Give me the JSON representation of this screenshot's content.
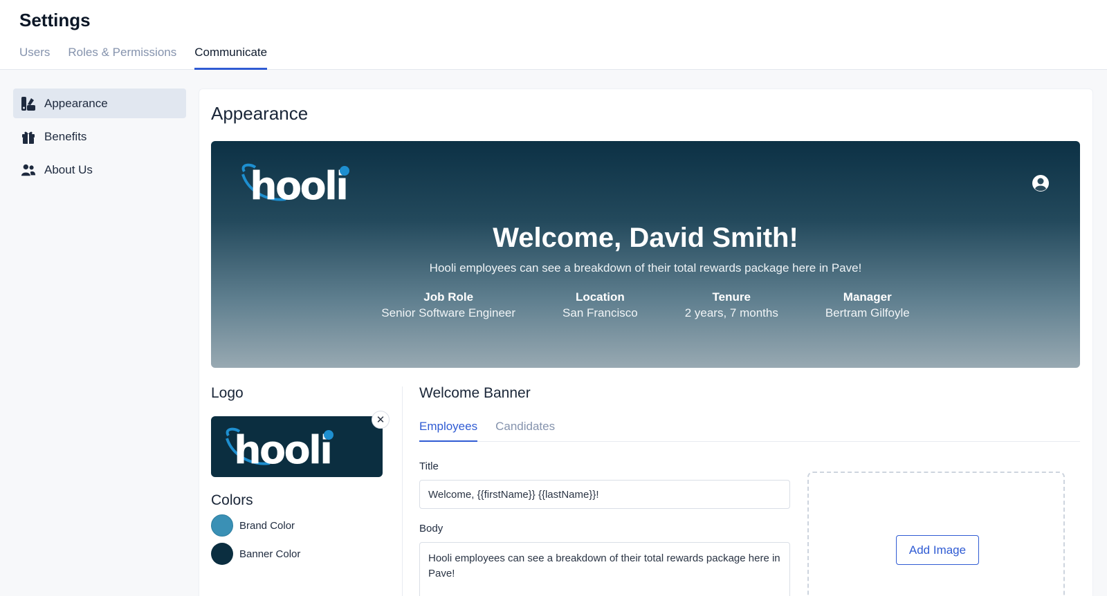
{
  "header": {
    "title": "Settings",
    "tabs": [
      {
        "label": "Users"
      },
      {
        "label": "Roles & Permissions"
      },
      {
        "label": "Communicate"
      }
    ],
    "active_tab": "Communicate"
  },
  "sidebar": {
    "items": [
      {
        "label": "Appearance",
        "icon": "appearance-icon",
        "active": true
      },
      {
        "label": "Benefits",
        "icon": "gift-icon",
        "active": false
      },
      {
        "label": "About Us",
        "icon": "people-icon",
        "active": false
      }
    ]
  },
  "main": {
    "title": "Appearance",
    "banner": {
      "logo_text": "hooli",
      "heading": "Welcome, David Smith!",
      "subheading": "Hooli employees can see a breakdown of their total rewards package here in Pave!",
      "stats": [
        {
          "label": "Job Role",
          "value": "Senior Software Engineer"
        },
        {
          "label": "Location",
          "value": "San Francisco"
        },
        {
          "label": "Tenure",
          "value": "2 years, 7 months"
        },
        {
          "label": "Manager",
          "value": "Bertram Gilfoyle"
        }
      ]
    },
    "logo_section": {
      "label": "Logo",
      "logo_text": "hooli"
    },
    "colors_section": {
      "label": "Colors",
      "colors": [
        {
          "name": "Brand Color",
          "hex": "#3a90b5"
        },
        {
          "name": "Banner Color",
          "hex": "#0b2e40"
        }
      ]
    },
    "welcome_banner": {
      "title": "Welcome Banner",
      "tabs": [
        {
          "label": "Employees"
        },
        {
          "label": "Candidates"
        }
      ],
      "active_tab": "Employees",
      "title_label": "Title",
      "title_value": "Welcome, {{firstName}} {{lastName}}!",
      "body_label": "Body",
      "body_value": "Hooli employees can see a breakdown of their total rewards package here in Pave!",
      "add_image_label": "Add Image"
    }
  },
  "colors": {
    "accent": "#2f5bd3",
    "banner_top": "#0c3145",
    "brand": "#3a90b5"
  }
}
